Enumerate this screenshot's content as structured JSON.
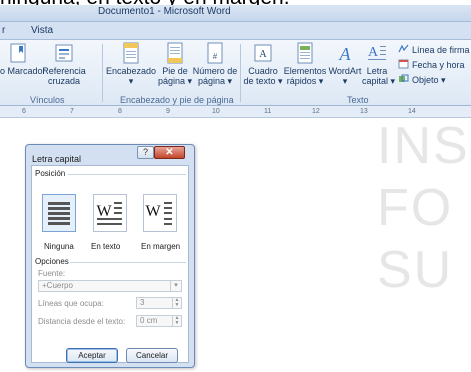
{
  "caption": "ninguna, en texto y en margen.",
  "window": {
    "title": "Documento1 - Microsoft Word"
  },
  "tabs": {
    "partial": "r",
    "vista": "Vista"
  },
  "ribbon": {
    "vinculos": {
      "marcador_partial": "o Marcador",
      "referencia_line1": "Referencia",
      "referencia_line2": "cruzada",
      "group_label": "Vínculos"
    },
    "encabezado": {
      "encabezado_label": "Encabezado",
      "encabezado_arrow": "▾",
      "pie_line1": "Pie de",
      "pie_line2": "página ▾",
      "numero_line1": "Número de",
      "numero_line2": "página ▾",
      "group_label": "Encabezado y pie de página"
    },
    "texto": {
      "cuadro_line1": "Cuadro",
      "cuadro_line2": "de texto ▾",
      "elementos_line1": "Elementos",
      "elementos_line2": "rápidos ▾",
      "wordart_line1": "WordArt",
      "wordart_line2": "▾",
      "letra_line1": "Letra",
      "letra_line2": "capital ▾",
      "linea_firma": "Línea de firma ▾",
      "fecha_hora": "Fecha y hora",
      "objeto": "Objeto ▾",
      "group_label": "Texto"
    }
  },
  "ruler": {
    "numbers": [
      "6",
      "7",
      "8",
      "9",
      "10",
      "11",
      "12",
      "13",
      "14"
    ]
  },
  "watermark": {
    "line1": "INS",
    "line2": "FO",
    "line3": "SU"
  },
  "dialog": {
    "title": "Letra capital",
    "help": "?",
    "close": "✕",
    "posicion_label": "Posición",
    "options": [
      {
        "label": "Ninguna",
        "selected": true
      },
      {
        "label": "En texto",
        "selected": false
      },
      {
        "label": "En margen",
        "selected": false
      }
    ],
    "opciones_label": "Opciones",
    "fuente_label": "Fuente:",
    "fuente_value": "+Cuerpo",
    "lineas_label": "Líneas que ocupa:",
    "lineas_value": "3",
    "distancia_label": "Distancia desde el texto:",
    "distancia_value": "0 cm",
    "aceptar": "Aceptar",
    "cancelar": "Cancelar"
  },
  "colors": {
    "ribbon_text": "#1c3a63",
    "close_button": "#c2462b",
    "dialog_bg": "#d3e0f1"
  },
  "icons": [
    "bookmark-icon",
    "cross-reference-icon",
    "header-icon",
    "footer-icon",
    "page-number-icon",
    "text-box-icon",
    "quick-parts-icon",
    "wordart-icon",
    "drop-cap-icon",
    "signature-line-icon",
    "date-time-icon",
    "object-icon",
    "drop-cap-none-icon",
    "drop-cap-in-text-icon",
    "drop-cap-in-margin-icon"
  ]
}
